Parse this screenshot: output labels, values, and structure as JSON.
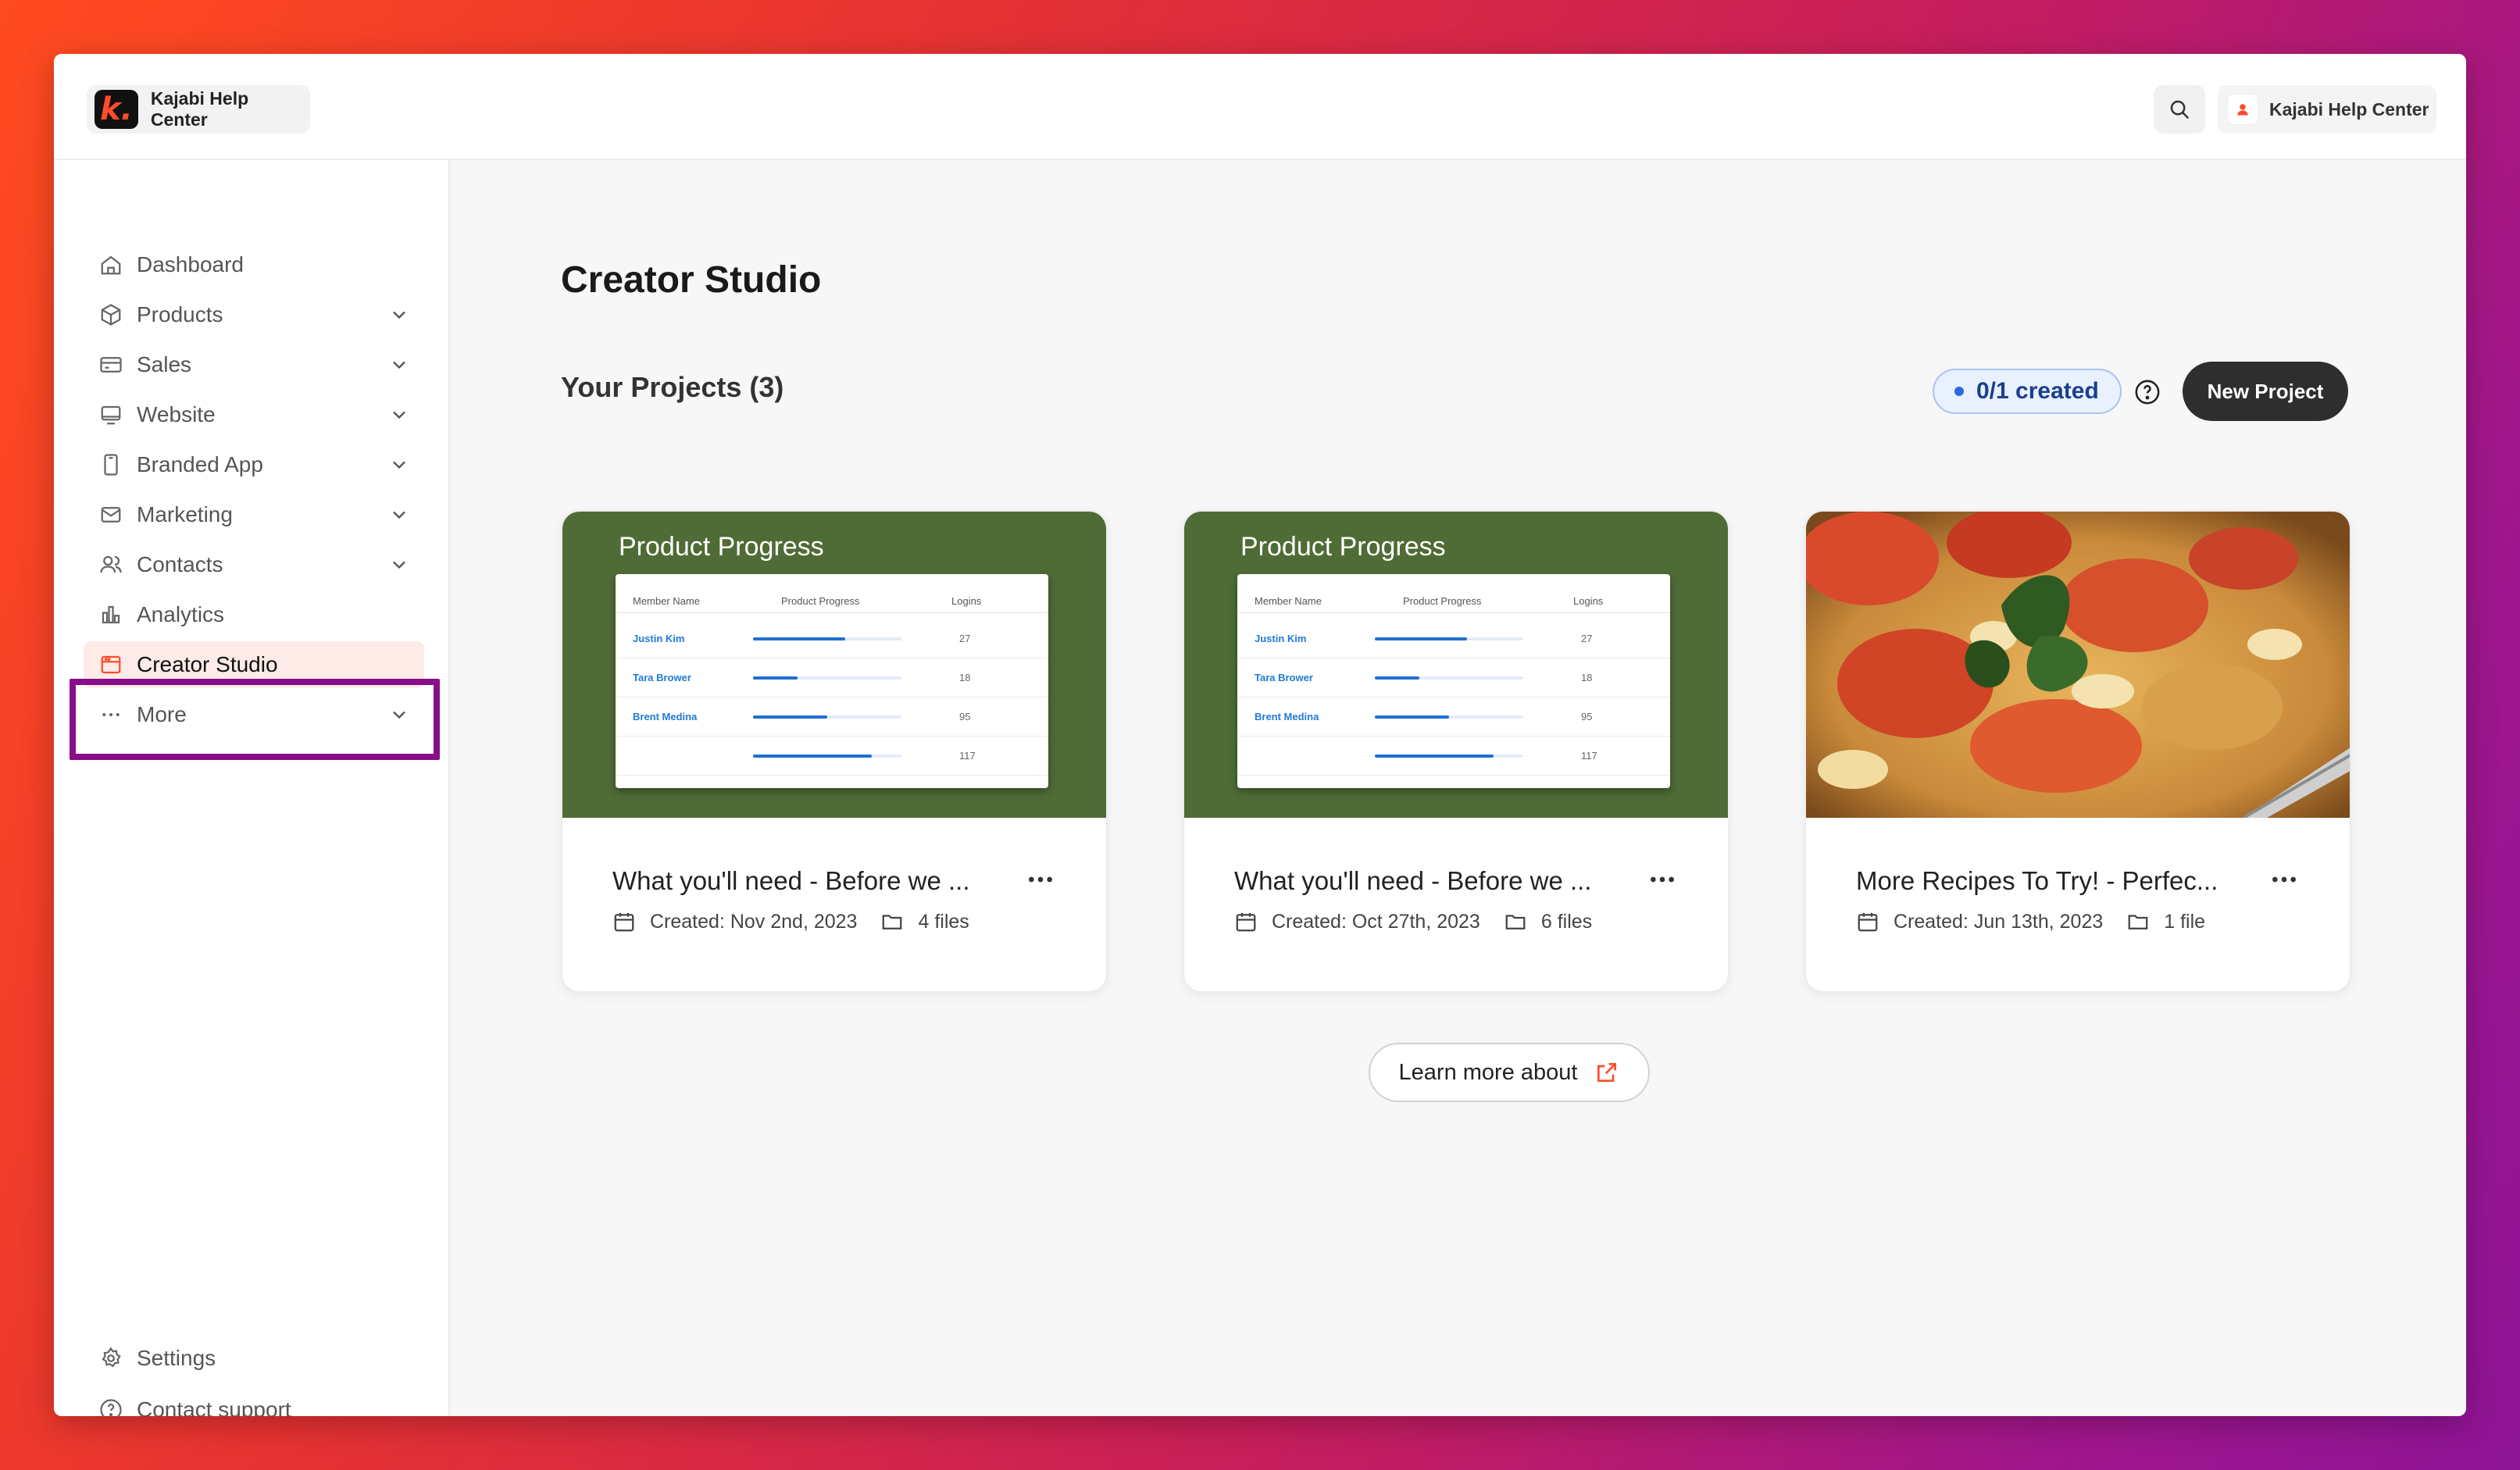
{
  "brand": {
    "name": "Kajabi Help Center",
    "logo_letter": "k."
  },
  "account": {
    "name": "Kajabi Help Center"
  },
  "sidebar": {
    "items": [
      {
        "label": "Dashboard"
      },
      {
        "label": "Products"
      },
      {
        "label": "Sales"
      },
      {
        "label": "Website"
      },
      {
        "label": "Branded App"
      },
      {
        "label": "Marketing"
      },
      {
        "label": "Contacts"
      },
      {
        "label": "Analytics"
      },
      {
        "label": "Creator Studio"
      },
      {
        "label": "More"
      }
    ],
    "footer": [
      {
        "label": "Settings"
      },
      {
        "label": "Contact support"
      }
    ]
  },
  "main": {
    "title": "Creator Studio",
    "section_title": "Your Projects (3)",
    "created_badge": "0/1 created",
    "new_project_label": "New Project",
    "learn_more_label": "Learn more about",
    "thumb_title": "Product Progress",
    "thumb_table": {
      "headers": [
        "Member Name",
        "Product Progress",
        "Logins"
      ],
      "rows": [
        {
          "name": "Justin Kim",
          "progress": 0.62,
          "logins": "27"
        },
        {
          "name": "Tara Brower",
          "progress": 0.3,
          "logins": "18"
        },
        {
          "name": "Brent Medina",
          "progress": 0.5,
          "logins": "95"
        },
        {
          "name": "",
          "progress": 0.8,
          "logins": "117"
        }
      ]
    },
    "projects": [
      {
        "title": "What you'll need - Before we ...",
        "created": "Created: Nov 2nd, 2023",
        "files": "4 files"
      },
      {
        "title": "What you'll need - Before we ...",
        "created": "Created: Oct 27th, 2023",
        "files": "6 files"
      },
      {
        "title": "More Recipes To Try! - Perfec...",
        "created": "Created: Jun 13th, 2023",
        "files": "1 file"
      }
    ]
  },
  "colors": {
    "accent": "#ff4b2b",
    "thumb_green": "#4f6b36",
    "highlight": "#8a0d8a",
    "active_bg": "#fdebe7"
  }
}
